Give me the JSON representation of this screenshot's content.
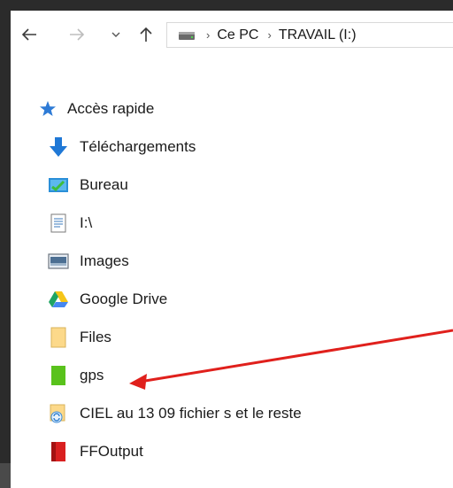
{
  "nav": {
    "back_icon": "arrow-left-icon",
    "forward_icon": "arrow-right-icon",
    "recent_icon": "chevron-down-icon",
    "up_icon": "arrow-up-icon"
  },
  "address": {
    "drive_icon": "drive-icon",
    "crumbs": [
      "Ce PC",
      "TRAVAIL (I:)"
    ]
  },
  "tree": {
    "quick_access": "Accès rapide",
    "items": [
      {
        "label": "Téléchargements",
        "icon": "download-arrow-icon"
      },
      {
        "label": "Bureau",
        "icon": "desktop-icon"
      },
      {
        "label": "I:\\",
        "icon": "document-icon"
      },
      {
        "label": "Images",
        "icon": "images-icon"
      },
      {
        "label": "Google Drive",
        "icon": "google-drive-icon"
      },
      {
        "label": "Files",
        "icon": "folder-icon"
      },
      {
        "label": "gps",
        "icon": "green-folder-icon"
      },
      {
        "label": "CIEL au 13 09 fichier s et le reste",
        "icon": "sync-folder-icon"
      },
      {
        "label": "FFOutput",
        "icon": "red-folder-icon"
      }
    ]
  },
  "colors": {
    "annotation_arrow": "#e0201c",
    "star": "#2e7bd6",
    "gps_folder": "#59c21c"
  }
}
